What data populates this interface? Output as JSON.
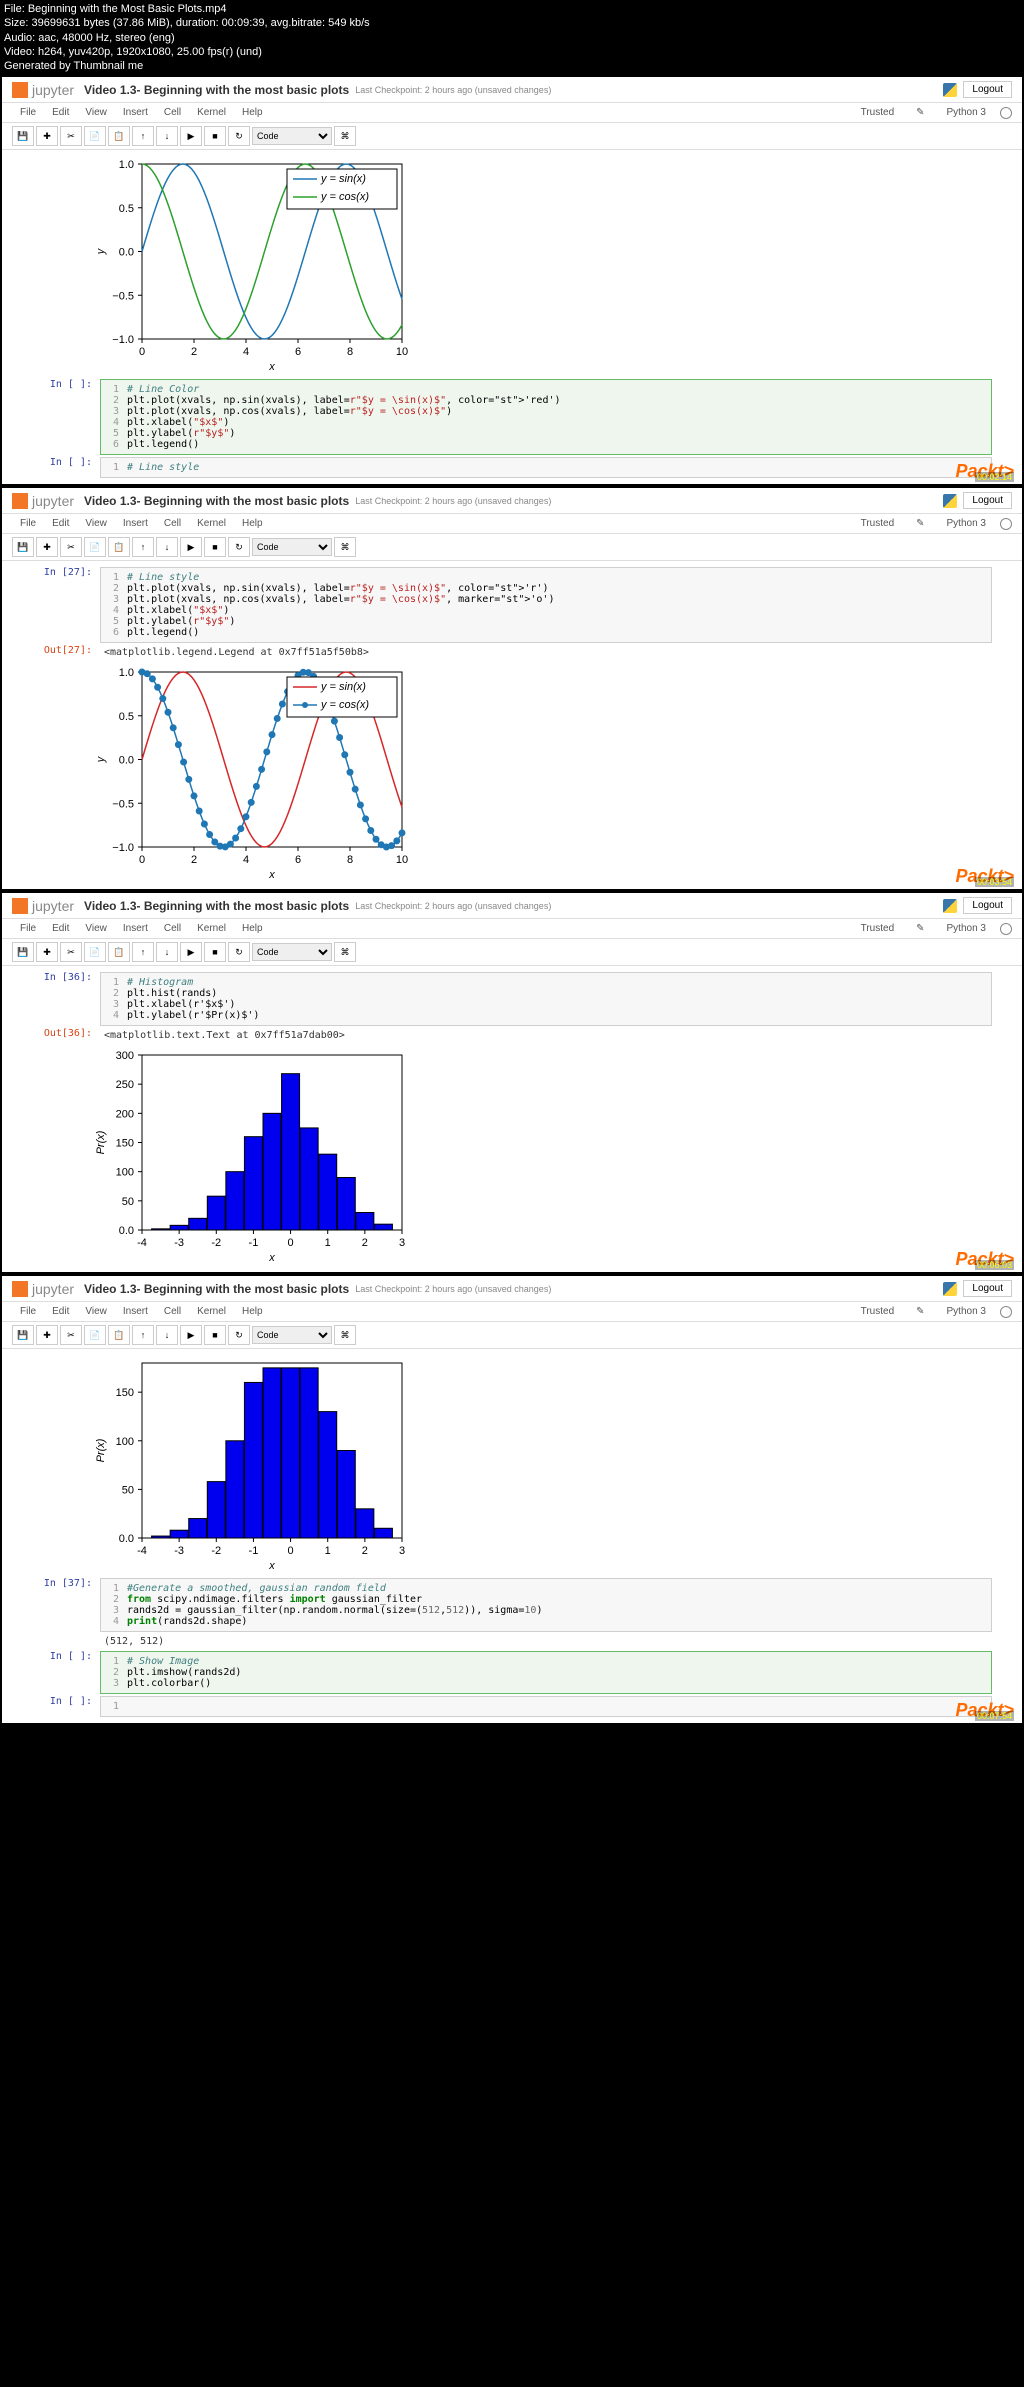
{
  "meta": {
    "file": "File: Beginning with the Most Basic Plots.mp4",
    "size": "Size: 39699631 bytes (37.86 MiB), duration: 00:09:39, avg.bitrate: 549 kb/s",
    "audio": "Audio: aac, 48000 Hz, stereo (eng)",
    "video": "Video: h264, yuv420p, 1920x1080, 25.00 fps(r) (und)",
    "gen": "Generated by Thumbnail me"
  },
  "common": {
    "logo": "jupyter",
    "title": "Video 1.3- Beginning with the most basic plots",
    "checkpoint": "Last Checkpoint: 2 hours ago (unsaved changes)",
    "logout": "Logout",
    "trusted": "Trusted",
    "kernel": "Python 3",
    "menus": [
      "File",
      "Edit",
      "View",
      "Insert",
      "Cell",
      "Kernel",
      "Help"
    ],
    "celltype": "Code",
    "watermark": "Packt>"
  },
  "chart_data": [
    {
      "type": "line",
      "title": "",
      "xlabel": "x",
      "ylabel": "y",
      "xlim": [
        0,
        10
      ],
      "ylim": [
        -1,
        1
      ],
      "series": [
        {
          "name": "y = sin(x)",
          "color": "#1f77b4",
          "style": "solid"
        },
        {
          "name": "y = cos(x)",
          "color": "#2ca02c",
          "style": "solid"
        }
      ],
      "xticks": [
        0,
        2,
        4,
        6,
        8,
        10
      ],
      "yticks": [
        -1,
        -0.5,
        0,
        0.5,
        1
      ]
    },
    {
      "type": "line",
      "title": "",
      "xlabel": "x",
      "ylabel": "y",
      "xlim": [
        0,
        10
      ],
      "ylim": [
        -1,
        1
      ],
      "series": [
        {
          "name": "y = sin(x)",
          "color": "#d62728",
          "style": "solid"
        },
        {
          "name": "y = cos(x)",
          "color": "#1f77b4",
          "style": "marker-circle"
        }
      ],
      "xticks": [
        0,
        2,
        4,
        6,
        8,
        10
      ],
      "yticks": [
        -1,
        -0.5,
        0,
        0.5,
        1
      ]
    },
    {
      "type": "bar",
      "title": "",
      "xlabel": "x",
      "ylabel": "Pr(x)",
      "xlim": [
        -4,
        3
      ],
      "ylim": [
        0,
        300
      ],
      "categories": [
        -3.5,
        -3,
        -2.5,
        -2,
        -1.5,
        -1,
        -0.5,
        0,
        0.5,
        1,
        1.5,
        2,
        2.5
      ],
      "values": [
        2,
        8,
        20,
        58,
        100,
        160,
        200,
        268,
        175,
        130,
        90,
        30,
        10
      ],
      "xticks": [
        -4,
        -3,
        -2,
        -1,
        0,
        1,
        2,
        3
      ],
      "yticks": [
        0,
        50,
        100,
        150,
        200,
        250,
        300
      ]
    },
    {
      "type": "bar",
      "title": "",
      "xlabel": "x",
      "ylabel": "Pr(x)",
      "xlim": [
        -4,
        3
      ],
      "ylim": [
        0,
        180
      ],
      "categories": [
        -3.5,
        -3,
        -2.5,
        -2,
        -1.5,
        -1,
        -0.5,
        0,
        0.5,
        1,
        1.5,
        2,
        2.5
      ],
      "values": [
        2,
        8,
        20,
        58,
        100,
        160,
        175,
        175,
        175,
        130,
        90,
        30,
        10
      ],
      "xticks": [
        -4,
        -3,
        -2,
        -1,
        0,
        1,
        2,
        3
      ],
      "yticks": [
        0,
        50,
        100,
        150
      ]
    }
  ],
  "frames": [
    {
      "cells": [
        {
          "type": "in",
          "prompt": "In [ ]:",
          "sel": true,
          "code": [
            {
              "n": "1",
              "t": "# Line Color",
              "c": "cm"
            },
            {
              "n": "2",
              "t": "plt.plot(xvals, np.sin(xvals), label=r\"$y = \\sin(x)$\", color='red')"
            },
            {
              "n": "3",
              "t": "plt.plot(xvals, np.cos(xvals), label=r\"$y = \\cos(x)$\")"
            },
            {
              "n": "4",
              "t": "plt.xlabel(\"$x$\")"
            },
            {
              "n": "5",
              "t": "plt.ylabel(r\"$y$\")"
            },
            {
              "n": "6",
              "t": "plt.legend()"
            }
          ]
        },
        {
          "type": "in",
          "prompt": "In [ ]:",
          "code": [
            {
              "n": "1",
              "t": "# Line style",
              "c": "cm"
            }
          ]
        }
      ],
      "plot": 0,
      "ts": "00:02:14"
    },
    {
      "cells": [
        {
          "type": "in",
          "prompt": "In [27]:",
          "code": [
            {
              "n": "1",
              "t": "# Line style",
              "c": "cm"
            },
            {
              "n": "2",
              "t": "plt.plot(xvals, np.sin(xvals), label=r\"$y = \\sin(x)$\", color='r')"
            },
            {
              "n": "3",
              "t": "plt.plot(xvals, np.cos(xvals), label=r\"$y = \\cos(x)$\", marker='o')"
            },
            {
              "n": "4",
              "t": "plt.xlabel(\"$x$\")"
            },
            {
              "n": "5",
              "t": "plt.ylabel(r\"$y$\")"
            },
            {
              "n": "6",
              "t": "plt.legend()"
            }
          ]
        },
        {
          "type": "out",
          "prompt": "Out[27]:",
          "text": "<matplotlib.legend.Legend at 0x7ff51a5f50b8>"
        }
      ],
      "plot": 1,
      "plotAfter": true,
      "ts": "00:03:54"
    },
    {
      "cells": [
        {
          "type": "in",
          "prompt": "In [36]:",
          "code": [
            {
              "n": "1",
              "t": "# Histogram",
              "c": "cm"
            },
            {
              "n": "2",
              "t": "plt.hist(rands)"
            },
            {
              "n": "3",
              "t": "plt.xlabel(r'$x$')"
            },
            {
              "n": "4",
              "t": "plt.ylabel(r'$Pr(x)$')"
            }
          ]
        },
        {
          "type": "out",
          "prompt": "Out[36]:",
          "text": "<matplotlib.text.Text at 0x7ff51a7dab00>"
        }
      ],
      "plot": 2,
      "plotAfter": true,
      "ts": "00:06:03"
    },
    {
      "cells": [
        {
          "type": "in",
          "prompt": "In [37]:",
          "code": [
            {
              "n": "1",
              "t": "#Generate a smoothed, gaussian random field",
              "c": "cm"
            },
            {
              "n": "2",
              "t": "from scipy.ndimage.filters import gaussian_filter"
            },
            {
              "n": "3",
              "t": "rands2d = gaussian_filter(np.random.normal(size=(512,512)), sigma=10)"
            },
            {
              "n": "4",
              "t": "print(rands2d.shape)"
            }
          ]
        },
        {
          "type": "plain",
          "text": "(512, 512)"
        },
        {
          "type": "in",
          "prompt": "In [ ]:",
          "sel": true,
          "code": [
            {
              "n": "1",
              "t": "# Show Image",
              "c": "cm"
            },
            {
              "n": "2",
              "t": "plt.imshow(rands2d)"
            },
            {
              "n": "3",
              "t": "plt.colorbar()"
            }
          ]
        },
        {
          "type": "in",
          "prompt": "In [ ]:",
          "code": [
            {
              "n": "1",
              "t": ""
            }
          ]
        }
      ],
      "plot": 3,
      "plotBefore": true,
      "ts": "00:07:54"
    }
  ]
}
